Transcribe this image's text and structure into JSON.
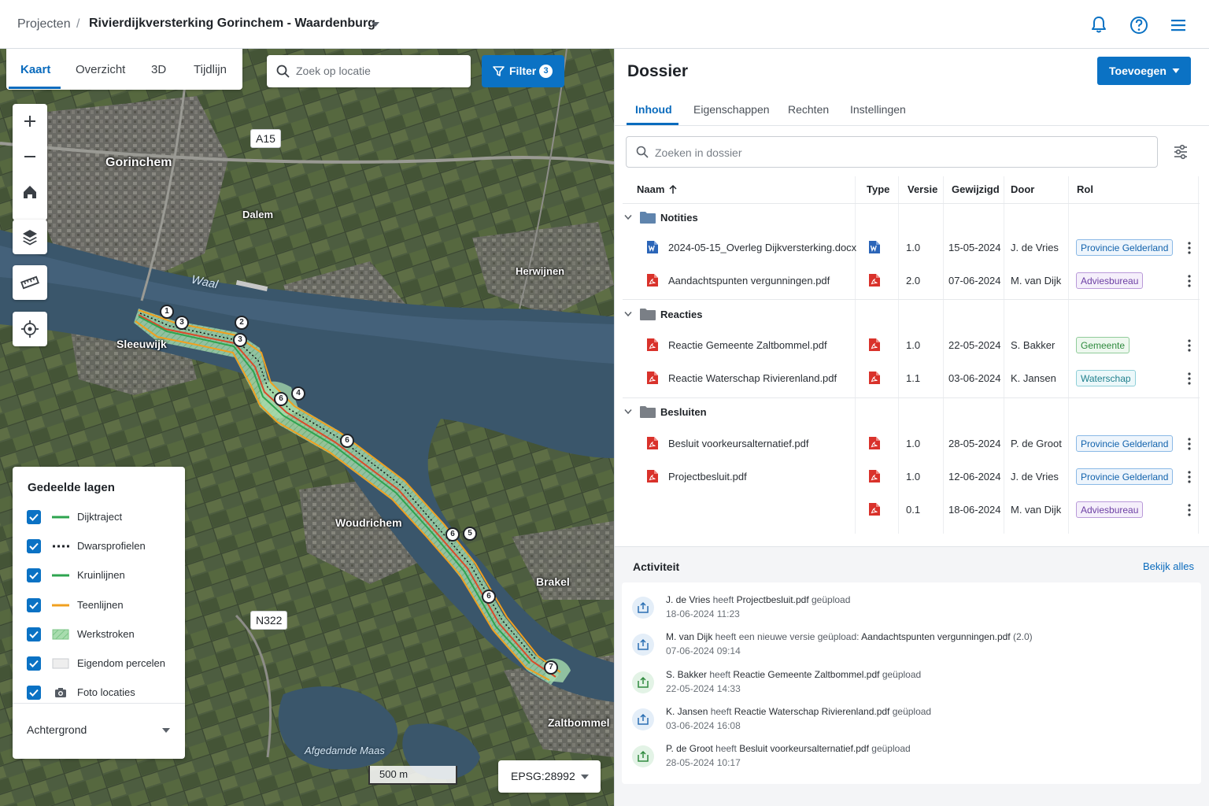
{
  "header": {
    "breadcrumb_root": "Projecten",
    "breadcrumb_sep": "/",
    "project_title": "Rivierdijkversterking Gorinchem - Waardenburg"
  },
  "map": {
    "tabs": [
      "Kaart",
      "Overzicht",
      "3D",
      "Tijdlijn"
    ],
    "active_tab": "Kaart",
    "search_placeholder": "Zoek op locatie",
    "filter_label": "Filter",
    "filter_count": "3",
    "roads": {
      "a15": "A15",
      "n322": "N322"
    },
    "places": {
      "gorinchem": "Gorinchem",
      "dalem": "Dalem",
      "herwijnen": "Herwijnen",
      "sleeuwijk": "Sleeuwijk",
      "woudrichem": "Woudrichem",
      "brakel": "Brakel",
      "zaltbommel": "Zaltbommel"
    },
    "water": {
      "waal": "Waal",
      "afgedamde_maas": "Afgedamde Maas"
    },
    "markers": [
      "1",
      "3",
      "2",
      "3",
      "4",
      "6",
      "6",
      "6",
      "5",
      "6",
      "7"
    ],
    "legend": {
      "title": "Gedeelde lagen",
      "layers": [
        {
          "label": "Dijktraject",
          "checked": true,
          "symbol": "solid-green-line",
          "color": "#2ea44f"
        },
        {
          "label": "Dwarsprofielen",
          "checked": true,
          "symbol": "dotted-black-line",
          "color": "#1f2328"
        },
        {
          "label": "Kruinlijnen",
          "checked": true,
          "symbol": "solid-green-line",
          "color": "#2ea44f"
        },
        {
          "label": "Teenlijnen",
          "checked": true,
          "symbol": "solid-orange-line",
          "color": "#f0a020"
        },
        {
          "label": "Werkstroken",
          "checked": true,
          "symbol": "green-hatched-fill",
          "color": "#a8dcae"
        },
        {
          "label": "Eigendom percelen",
          "checked": true,
          "symbol": "light-grey-fill",
          "color": "#eeeeee"
        },
        {
          "label": "Foto locaties",
          "checked": true,
          "symbol": "camera-icon",
          "color": "#555b63"
        }
      ],
      "background_label": "Achtergrond"
    },
    "scale_label": "500 m",
    "crs_label": "EPSG:28992"
  },
  "dossier": {
    "title": "Dossier",
    "add_label": "Toevoegen",
    "tabs": [
      "Inhoud",
      "Eigenschappen",
      "Rechten",
      "Instellingen"
    ],
    "active_tab": "Inhoud",
    "search_placeholder": "Zoeken in dossier",
    "columns": [
      "Naam",
      "Type",
      "Versie",
      "Gewijzigd",
      "Door",
      "Rol"
    ],
    "sort_column": "Naam",
    "groups": [
      {
        "name": "Notities",
        "expanded": true
      },
      {
        "name": "Reacties",
        "expanded": true
      },
      {
        "name": "Besluiten",
        "expanded": true
      }
    ],
    "rows": [
      {
        "name": "2024-05-15_Overleg Dijkversterking.docx",
        "type": "word",
        "version": "1.0",
        "date": "15-05-2024",
        "by": "J. de Vries",
        "role": "Provincie Gelderland"
      },
      {
        "name": "Aandachtspunten vergunningen.pdf",
        "type": "pdf",
        "version": "2.0",
        "date": "07-06-2024",
        "by": "M. van Dijk",
        "role": "Adviesbureau"
      },
      {
        "name": "Reactie Gemeente Zaltbommel.pdf",
        "type": "pdf",
        "version": "1.0",
        "date": "22-05-2024",
        "by": "S. Bakker",
        "role": "Gemeente"
      },
      {
        "name": "Reactie Waterschap Rivierenland.pdf",
        "type": "pdf",
        "version": "1.1",
        "date": "03-06-2024",
        "by": "K. Jansen",
        "role": "Waterschap"
      },
      {
        "name": "Besluit voorkeursalternatief.pdf",
        "type": "pdf",
        "version": "1.0",
        "date": "28-05-2024",
        "by": "P. de Groot",
        "role": "Provincie Gelderland"
      },
      {
        "name": "Projectbesluit.pdf",
        "type": "pdf",
        "version": "1.0",
        "date": "12-06-2024",
        "by": "J. de Vries",
        "role": "Provincie Gelderland"
      },
      {
        "name": "",
        "type": "pdf",
        "version": "0.1",
        "date": "18-06-2024",
        "by": "M. van Dijk",
        "role": "Adviesbureau"
      }
    ],
    "role_colors": {
      "provincie": "#1263ad",
      "adviesbureau": "#6c3fa3",
      "gemeente": "#2f8a3e",
      "waterschap": "#1f7f8c"
    }
  },
  "activity": {
    "title": "Activiteit",
    "view_all": "Bekijk alles",
    "items": [
      {
        "user": "J. de Vries",
        "verb": " heeft ",
        "object": "Projectbesluit.pdf",
        "suffix": " geüpload",
        "time": "18-06-2024 11:23"
      },
      {
        "user": "M. van Dijk",
        "verb": " heeft een nieuwe versie geüpload: ",
        "object": "Aandachtspunten vergunningen.pdf",
        "suffix": " (2.0)",
        "time": "07-06-2024 09:14"
      },
      {
        "user": "S. Bakker",
        "verb": " heeft ",
        "object": "Reactie Gemeente Zaltbommel.pdf",
        "suffix": " geüpload",
        "time": "22-05-2024 14:33"
      },
      {
        "user": "K. Jansen",
        "verb": " heeft ",
        "object": "Reactie Waterschap Rivierenland.pdf",
        "suffix": " geüpload",
        "time": "03-06-2024 16:08"
      },
      {
        "user": "P. de Groot",
        "verb": " heeft ",
        "object": "Besluit voorkeursalternatief.pdf",
        "suffix": " geüpload",
        "time": "28-05-2024 10:17"
      }
    ]
  }
}
